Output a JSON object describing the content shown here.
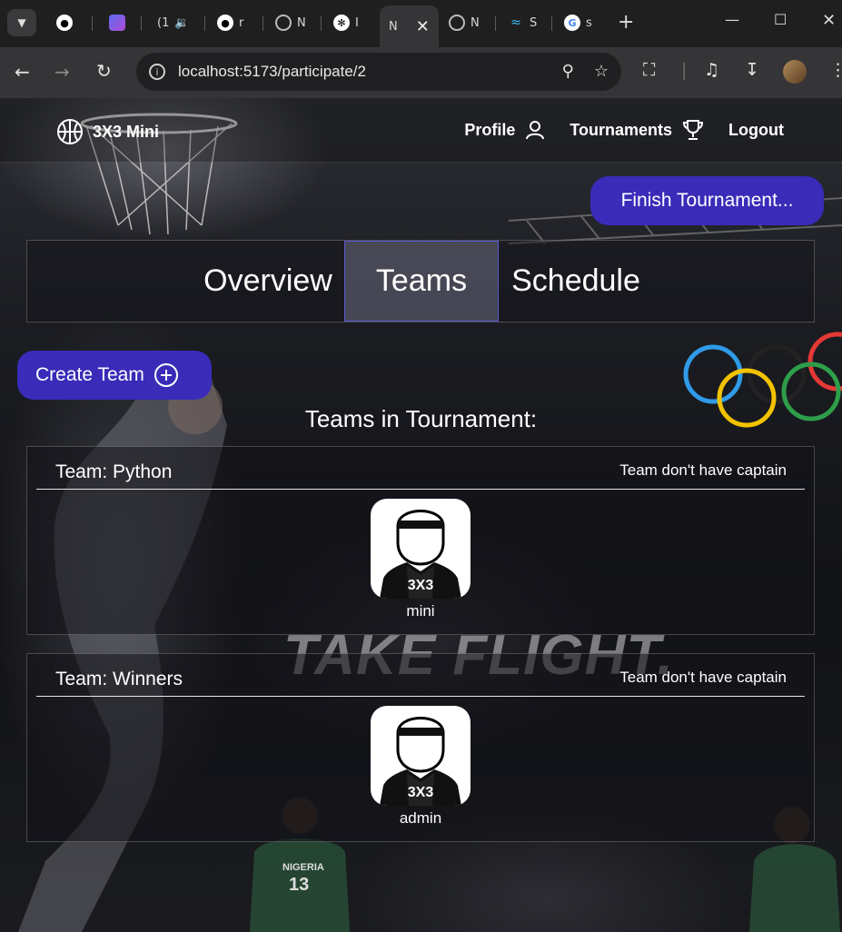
{
  "browser": {
    "tabs": [
      {
        "label": ""
      },
      {
        "label": ""
      },
      {
        "label": "(1"
      },
      {
        "label": "r"
      },
      {
        "label": "N"
      },
      {
        "label": "I"
      },
      {
        "label": "N"
      },
      {
        "label": "N"
      },
      {
        "label": "S"
      },
      {
        "label": "s"
      }
    ],
    "url": "localhost:5173/participate/2"
  },
  "navbar": {
    "brand": "3X3 Mini",
    "links": {
      "profile": "Profile",
      "tournaments": "Tournaments",
      "logout": "Logout"
    }
  },
  "actions": {
    "finish": "Finish Tournament...",
    "create_team": "Create Team"
  },
  "tabs": [
    {
      "label": "Overview",
      "active": false
    },
    {
      "label": "Teams",
      "active": true
    },
    {
      "label": "Schedule",
      "active": false
    }
  ],
  "teams_title": "Teams in Tournament:",
  "teams": [
    {
      "name": "Team: Python",
      "captain": "Team don't have captain",
      "members": [
        "mini"
      ]
    },
    {
      "name": "Team: Winners",
      "captain": "Team don't have captain",
      "members": [
        "admin"
      ]
    }
  ],
  "background_text": "TAKE FLIGHT.",
  "colors": {
    "accent": "#3a2bb8",
    "active_tab_border": "#5b5bd6"
  }
}
